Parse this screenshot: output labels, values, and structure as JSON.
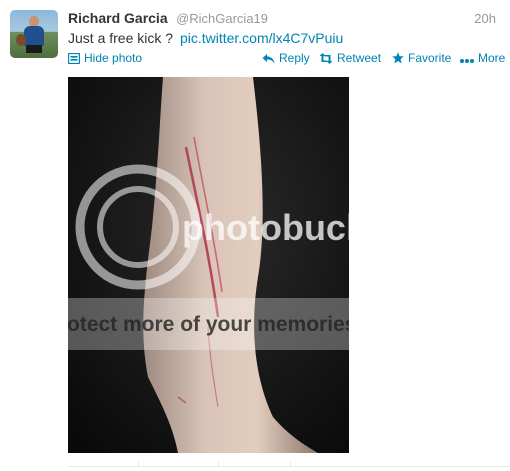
{
  "tweet": {
    "full_name": "Richard Garcia",
    "username": "@RichGarcia19",
    "timestamp": "20h",
    "text": "Just a free kick ?",
    "link": "pic.twitter.com/lx4C7vPuiu",
    "avatar_icon": "user-avatar-photo"
  },
  "actions": {
    "hide_photo": "Hide photo",
    "reply": "Reply",
    "retweet": "Retweet",
    "favorite": "Favorite",
    "more": "More"
  },
  "photo": {
    "watermark_brand": "photobucket",
    "watermark_slogan": "protect more of your memories"
  },
  "colors": {
    "link": "#0084b4",
    "name": "#333333",
    "meta": "#999999"
  }
}
